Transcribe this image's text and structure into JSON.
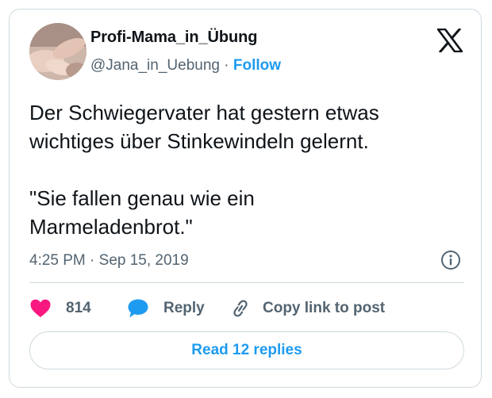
{
  "tweet": {
    "author": {
      "display_name": "Profi-Mama_in_Übung",
      "handle": "@Jana_in_Uebung",
      "separator": " · ",
      "follow_label": "Follow"
    },
    "text": "Der Schwiegervater hat gestern etwas\nwichtiges über Stinkewindeln gelernt.\n\n\"Sie fallen genau wie ein\nMarmeladenbrot.\"",
    "timestamp": "4:25 PM · Sep 15, 2019",
    "actions": {
      "like_count": "814",
      "reply_label": "Reply",
      "copy_label": "Copy link to post"
    },
    "read_replies_label": "Read 12 replies"
  },
  "icons": {
    "brand": "x-logo-icon",
    "info": "info-icon",
    "like": "heart-icon",
    "reply": "speech-bubble-icon",
    "copy": "link-icon"
  },
  "colors": {
    "accent": "#1d9bf0",
    "like": "#f91880",
    "text": "#0f1419",
    "muted": "#536471",
    "border": "#cfd9de"
  }
}
